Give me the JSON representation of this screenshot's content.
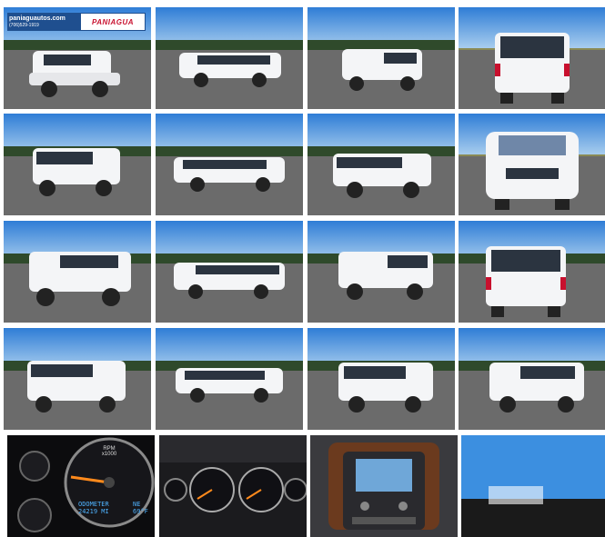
{
  "dealer_badge": {
    "url": "paniaguautos.com",
    "phone": "(706)529-1919",
    "brand": "PANIAGUA"
  },
  "gallery": {
    "rows": 5,
    "cols": 4
  },
  "cluster": {
    "rpm_label": "RPM",
    "rpm_scale": "x1000",
    "odometer_label": "ODOMETER",
    "odometer_value": "24219 MI",
    "compass": "NE",
    "temperature": "69°F"
  },
  "colors": {
    "sky": "#3b86d6",
    "vehicle": "#f4f5f7",
    "dealer_blue": "#1f4f8f",
    "dealer_red": "#c8102e"
  }
}
